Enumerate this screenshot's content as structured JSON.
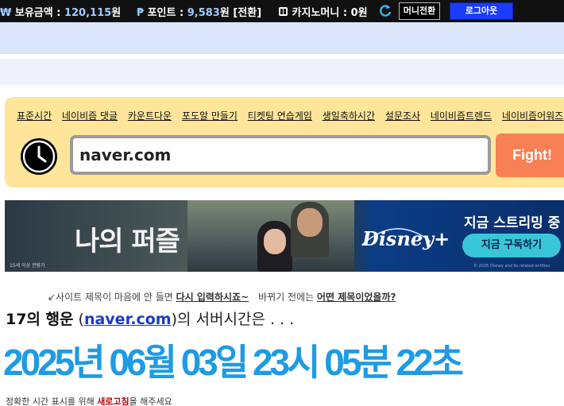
{
  "topbar": {
    "balance_symbol": "₩",
    "balance_label": "보유금액 : ",
    "balance_value": "120,115",
    "balance_unit": "원",
    "point_symbol": "₱",
    "point_label": "포인트 : ",
    "point_value": "9,583",
    "point_unit": "원",
    "point_exchange": "[전환]",
    "casino_label": "카지노머니 : 0원",
    "money_switch": "머니전환",
    "logout": "로그아웃"
  },
  "links": [
    "표준시간",
    "네이비즘 댓글",
    "카운트다운",
    "포도알 만들기",
    "티켓팅 연습게임",
    "생일축하시간",
    "설문조사",
    "네이비즘트렌드",
    "네이비즘어워즈"
  ],
  "search": {
    "value": "naver.com",
    "button": "Fight!"
  },
  "ad": {
    "title": "나의 퍼즐",
    "rating": "15세 이상 관람가",
    "brand": "Disney+",
    "streaming": "지금 스트리밍 중",
    "subscribe": "지금 구독하기",
    "copyright": "© 2025 Disney and its related entities"
  },
  "hint": {
    "part1": "↙사이트 제목이 마음에 안 들면 ",
    "retype": "다시 입력하시죠~",
    "part2": "바뀌기 전에는 ",
    "question": "어떤 제목이었을까?"
  },
  "server": {
    "lucky": "17의 행운",
    "open_paren": " (",
    "site": "naver.com",
    "close_paren": ")",
    "suffix": "의 서버시간은 . . ."
  },
  "time": "2025년 06월 03일 23시 05분 22초",
  "note": {
    "part1": "정확한 시간 표시를 위해 ",
    "refresh": "새로고침",
    "part2": "을 해주세요"
  },
  "colors": {
    "accent_blue": "#1e9be3",
    "panel_yellow": "#ffe59a",
    "fight_orange": "#f78055",
    "logout_blue": "#1a3cff"
  }
}
